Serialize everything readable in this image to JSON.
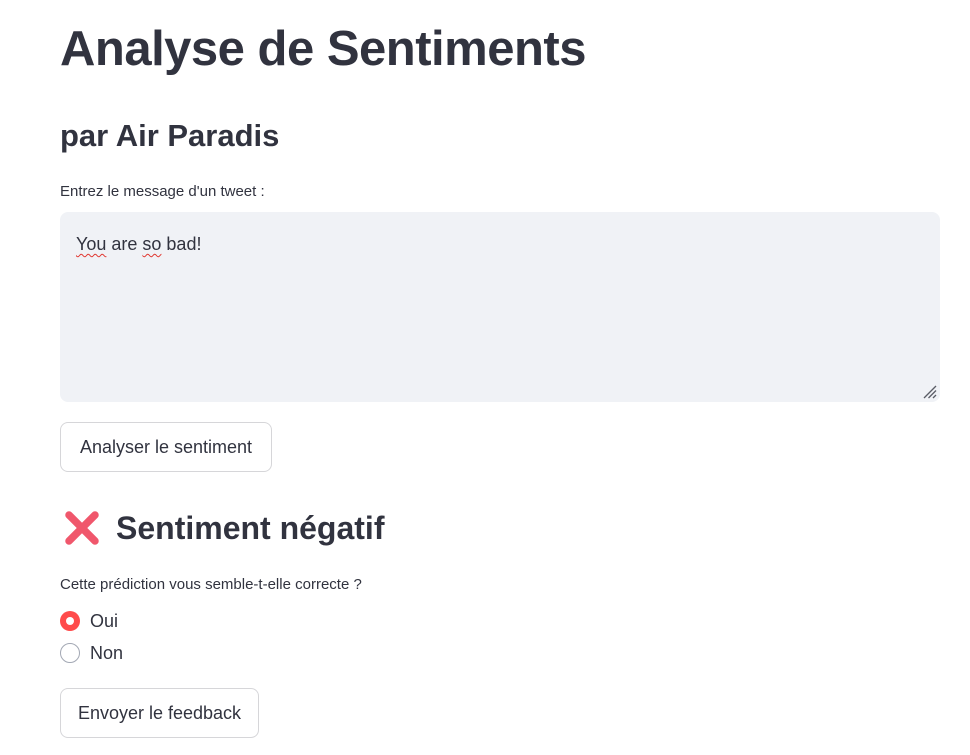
{
  "header": {
    "title": "Analyse de Sentiments",
    "subtitle": "par Air Paradis"
  },
  "tweet_input": {
    "label": "Entrez le message d'un tweet :",
    "value_parts": [
      "You",
      " are ",
      "so",
      " bad!"
    ]
  },
  "analyse_button": {
    "label": "Analyser le sentiment"
  },
  "result": {
    "icon": "cross-mark-icon",
    "icon_color": "#f0576c",
    "label": "Sentiment négatif"
  },
  "feedback": {
    "question": "Cette prédiction vous semble-t-elle correcte ?",
    "options": [
      {
        "label": "Oui",
        "selected": true
      },
      {
        "label": "Non",
        "selected": false
      }
    ],
    "accent_color": "#ff4b4b",
    "submit_label": "Envoyer le feedback"
  }
}
